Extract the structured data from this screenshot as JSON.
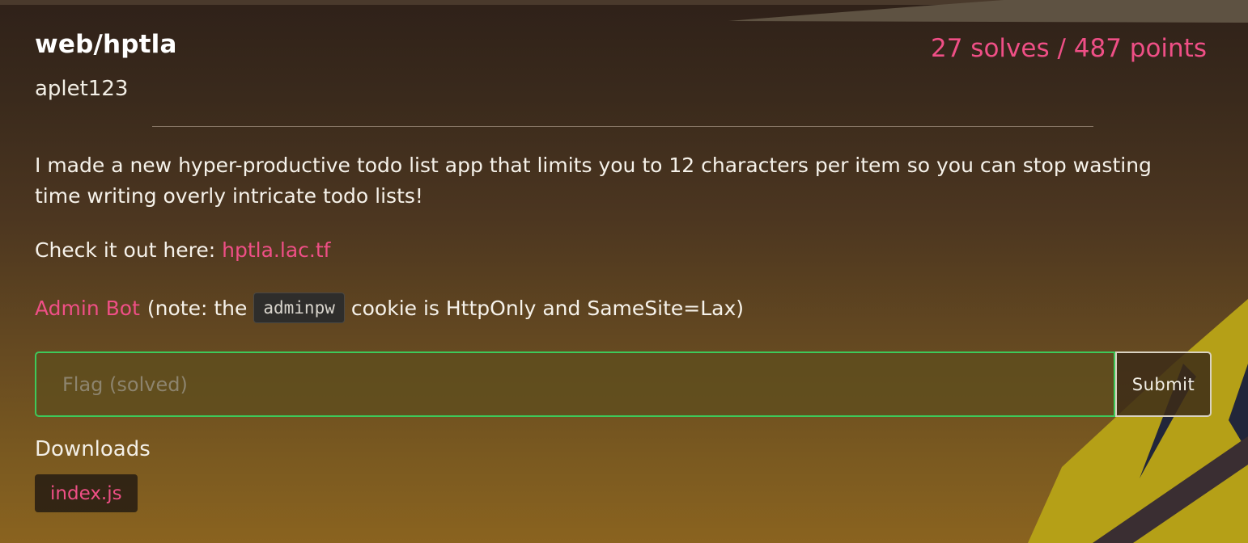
{
  "challenge": {
    "title": "web/hptla",
    "stats": "27 solves / 487 points",
    "author": "aplet123",
    "description": "I made a new hyper-productive todo list app that limits you to 12 characters per item so you can stop wasting time writing overly intricate todo lists!",
    "check_prefix": "Check it out here: ",
    "link_text": "hptla.lac.tf",
    "admin_bot_link": "Admin Bot",
    "admin_note_prefix": "(note: the",
    "admin_note_code": "adminpw",
    "admin_note_suffix": "cookie is HttpOnly and SameSite=Lax)"
  },
  "flag_form": {
    "placeholder": "Flag (solved)",
    "value": "",
    "submit_label": "Submit",
    "border_color": "#3ec95a"
  },
  "downloads": {
    "heading": "Downloads",
    "files": [
      "index.js"
    ]
  },
  "colors": {
    "accent": "#ef4f86",
    "text": "#f3efe6",
    "decoration_yellow": "#b5a017"
  }
}
